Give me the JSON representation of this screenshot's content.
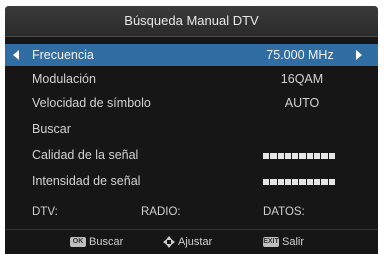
{
  "title": "Búsqueda Manual DTV",
  "menu": {
    "frecuencia": {
      "label": "Frecuencia",
      "value": "75.000 MHz"
    },
    "modulacion": {
      "label": "Modulación",
      "value": "16QAM"
    },
    "velocidad": {
      "label": "Velocidad de símbolo",
      "value": "AUTO"
    },
    "buscar": {
      "label": "Buscar"
    },
    "calidad": {
      "label": "Calidad de la señal"
    },
    "intensidad": {
      "label": "Intensidad de señal"
    }
  },
  "status": {
    "dtv": "DTV:",
    "radio": "RADIO:",
    "datos": "DATOS:"
  },
  "footer": {
    "buscar_label": "Buscar",
    "ajustar_label": "Ajustar",
    "salir_label": "Salir",
    "buscar_key": "OK",
    "salir_key": "EXIT"
  },
  "colors": {
    "selected_row": "#2f6da2",
    "background": "#161616",
    "title_bar": "#333333"
  },
  "icons": {
    "left": "arrow-left-icon",
    "right": "arrow-right-icon",
    "dpad": "dpad-icon"
  }
}
